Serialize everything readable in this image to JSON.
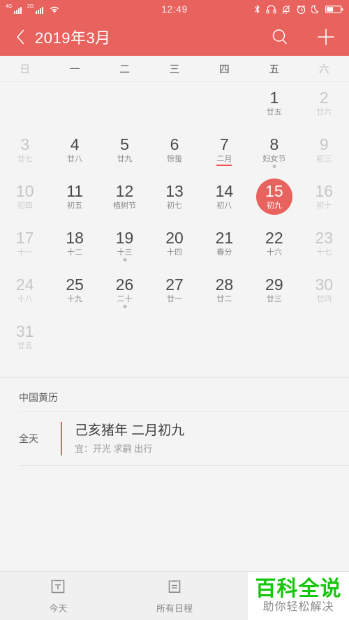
{
  "statusbar": {
    "time": "12:49",
    "left_icons": [
      "signal-4g-icon",
      "signal-2g-icon",
      "wifi-icon"
    ],
    "net_labels": [
      "4G",
      "2G"
    ],
    "right_icons": [
      "bluetooth-icon",
      "headphones-icon",
      "bell-mute-icon",
      "alarm-clock-icon",
      "moon-icon",
      "battery-icon"
    ]
  },
  "appbar": {
    "back_icon": "chevron-left-icon",
    "title": "2019年3月",
    "search_icon": "search-icon",
    "add_icon": "plus-icon"
  },
  "weekdays": [
    {
      "label": "日",
      "dim": true
    },
    {
      "label": "一",
      "dim": false
    },
    {
      "label": "二",
      "dim": false
    },
    {
      "label": "三",
      "dim": false
    },
    {
      "label": "四",
      "dim": false
    },
    {
      "label": "五",
      "dim": false
    },
    {
      "label": "六",
      "dim": true
    }
  ],
  "calendar": {
    "year": 2019,
    "month": 3,
    "selected_day": 15,
    "accent_color": "#e8625e",
    "weeks": [
      [
        {
          "num": "",
          "lunar": ""
        },
        {
          "num": "",
          "lunar": ""
        },
        {
          "num": "",
          "lunar": ""
        },
        {
          "num": "",
          "lunar": ""
        },
        {
          "num": "",
          "lunar": ""
        },
        {
          "num": "1",
          "lunar": "廿五"
        },
        {
          "num": "2",
          "lunar": "廿六",
          "dim": true
        }
      ],
      [
        {
          "num": "3",
          "lunar": "廿七",
          "dim": true
        },
        {
          "num": "4",
          "lunar": "廿八"
        },
        {
          "num": "5",
          "lunar": "廿九"
        },
        {
          "num": "6",
          "lunar": "惊蛰"
        },
        {
          "num": "7",
          "lunar": "二月",
          "underline": true
        },
        {
          "num": "8",
          "lunar": "妇女节",
          "dot": true
        },
        {
          "num": "9",
          "lunar": "初三",
          "dim": true
        }
      ],
      [
        {
          "num": "10",
          "lunar": "初四",
          "dim": true
        },
        {
          "num": "11",
          "lunar": "初五"
        },
        {
          "num": "12",
          "lunar": "植树节"
        },
        {
          "num": "13",
          "lunar": "初七"
        },
        {
          "num": "14",
          "lunar": "初八"
        },
        {
          "num": "15",
          "lunar": "初九",
          "selected": true
        },
        {
          "num": "16",
          "lunar": "初十",
          "dim": true
        }
      ],
      [
        {
          "num": "17",
          "lunar": "十一",
          "dim": true
        },
        {
          "num": "18",
          "lunar": "十二"
        },
        {
          "num": "19",
          "lunar": "十三",
          "dot": true
        },
        {
          "num": "20",
          "lunar": "十四"
        },
        {
          "num": "21",
          "lunar": "春分"
        },
        {
          "num": "22",
          "lunar": "十六"
        },
        {
          "num": "23",
          "lunar": "十七",
          "dim": true
        }
      ],
      [
        {
          "num": "24",
          "lunar": "十八",
          "dim": true
        },
        {
          "num": "25",
          "lunar": "十九"
        },
        {
          "num": "26",
          "lunar": "二十",
          "dot": true
        },
        {
          "num": "27",
          "lunar": "廿一"
        },
        {
          "num": "28",
          "lunar": "廿二"
        },
        {
          "num": "29",
          "lunar": "廿三"
        },
        {
          "num": "30",
          "lunar": "廿四",
          "dim": true
        }
      ],
      [
        {
          "num": "31",
          "lunar": "廿五",
          "dim": true
        },
        {
          "num": "",
          "lunar": ""
        },
        {
          "num": "",
          "lunar": ""
        },
        {
          "num": "",
          "lunar": ""
        },
        {
          "num": "",
          "lunar": ""
        },
        {
          "num": "",
          "lunar": ""
        },
        {
          "num": "",
          "lunar": ""
        }
      ]
    ]
  },
  "almanac": {
    "section_title": "中国黄历",
    "all_day_label": "全天",
    "event_title": "己亥猪年 二月初九",
    "event_subtitle": "宜：开光 求嗣 出行",
    "bar_color": "#e8625e"
  },
  "bottombar": {
    "tabs": [
      {
        "label": "今天",
        "icon": "calendar-today-icon"
      },
      {
        "label": "所有日程",
        "icon": "agenda-list-icon"
      }
    ],
    "watermark": {
      "main": "百科全说",
      "sub": "助你轻松解决",
      "color": "#16c60c"
    }
  }
}
